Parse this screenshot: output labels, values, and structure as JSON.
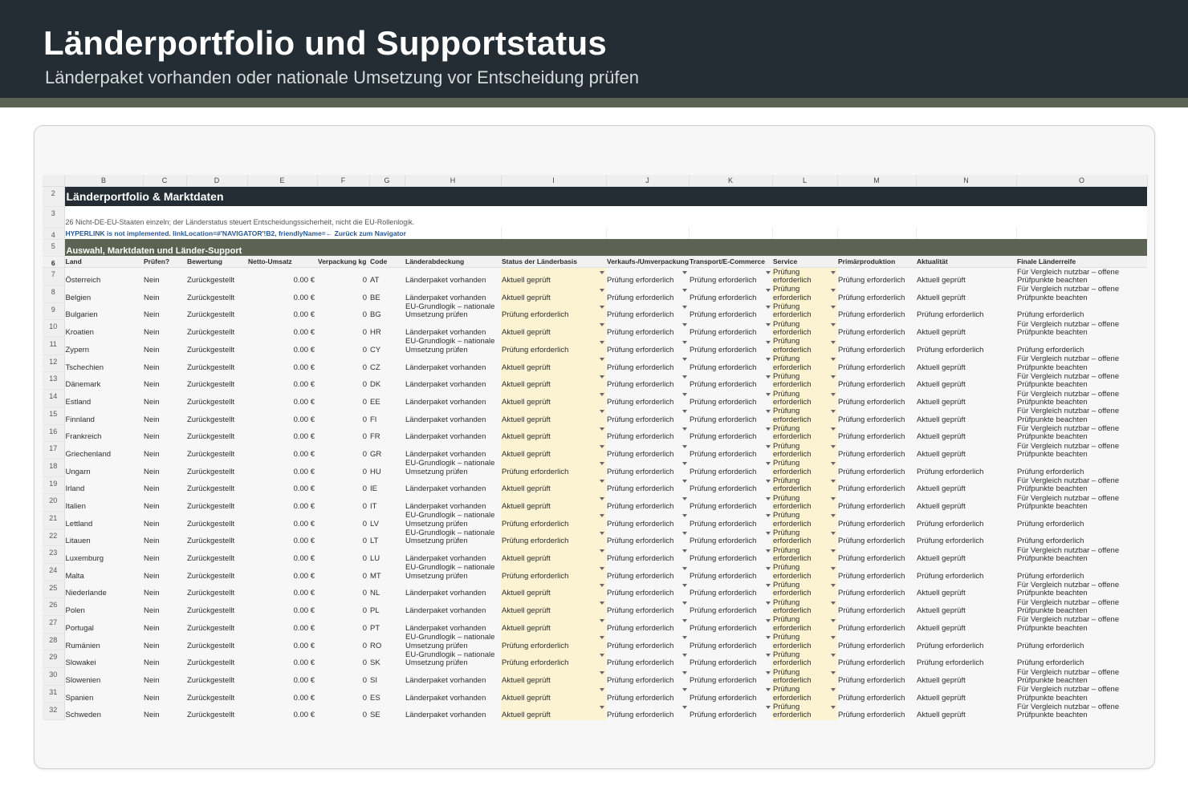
{
  "header": {
    "title": "Länderportfolio und Supportstatus",
    "subtitle": "Länderpaket vorhanden oder nationale Umsetzung vor Entscheidung prüfen"
  },
  "sheet": {
    "columns": [
      "B",
      "C",
      "D",
      "E",
      "F",
      "G",
      "H",
      "I",
      "J",
      "K",
      "L",
      "M",
      "N",
      "O"
    ],
    "title": "Länderportfolio & Marktdaten",
    "note": "26 Nicht-DE-EU-Staaten einzeln; der Länderstatus steuert Entscheidungssicherheit, nicht die EU-Rollenlogik.",
    "link": "HYPERLINK is not implemented. linkLocation=#'NAVIGATOR'!B2, friendlyName=← Zurück zum Navigator",
    "section": "Auswahl, Marktdaten und Länder-Support",
    "fields": [
      "Land",
      "Prüfen?",
      "Bewertung",
      "Netto-Umsatz",
      "Verpackung kg",
      "Code",
      "Länderabdeckung",
      "Status der Länderbasis",
      "Verkaufs-/Umverpackung",
      "Transport/E-Commerce",
      "Service",
      "Primärproduktion",
      "Aktualität",
      "Finale Länderreife"
    ],
    "rows": [
      {
        "n": "7",
        "land": "Österreich",
        "pruefen": "Nein",
        "bewertung": "Zurückgestellt",
        "umsatz": "0.00 €",
        "kg": "0",
        "code": "AT",
        "abdeckung": "Länderpaket vorhanden",
        "status": "Aktuell geprüft",
        "verkauf": "Prüfung erforderlich",
        "transport": "Prüfung erforderlich",
        "service": "Prüfung erforderlich",
        "primaer": "Prüfung erforderlich",
        "aktualitaet": "Aktuell geprüft",
        "reife": "Für Vergleich nutzbar – offene Prüfpunkte beachten"
      },
      {
        "n": "8",
        "land": "Belgien",
        "pruefen": "Nein",
        "bewertung": "Zurückgestellt",
        "umsatz": "0.00 €",
        "kg": "0",
        "code": "BE",
        "abdeckung": "Länderpaket vorhanden",
        "status": "Aktuell geprüft",
        "verkauf": "Prüfung erforderlich",
        "transport": "Prüfung erforderlich",
        "service": "Prüfung erforderlich",
        "primaer": "Prüfung erforderlich",
        "aktualitaet": "Aktuell geprüft",
        "reife": "Für Vergleich nutzbar – offene Prüfpunkte beachten"
      },
      {
        "n": "9",
        "land": "Bulgarien",
        "pruefen": "Nein",
        "bewertung": "Zurückgestellt",
        "umsatz": "0.00 €",
        "kg": "0",
        "code": "BG",
        "abdeckung": "EU-Grundlogik – nationale Umsetzung prüfen",
        "status": "Prüfung erforderlich",
        "verkauf": "Prüfung erforderlich",
        "transport": "Prüfung erforderlich",
        "service": "Prüfung erforderlich",
        "primaer": "Prüfung erforderlich",
        "aktualitaet": "Prüfung erforderlich",
        "reife": "Prüfung erforderlich"
      },
      {
        "n": "10",
        "land": "Kroatien",
        "pruefen": "Nein",
        "bewertung": "Zurückgestellt",
        "umsatz": "0.00 €",
        "kg": "0",
        "code": "HR",
        "abdeckung": "Länderpaket vorhanden",
        "status": "Aktuell geprüft",
        "verkauf": "Prüfung erforderlich",
        "transport": "Prüfung erforderlich",
        "service": "Prüfung erforderlich",
        "primaer": "Prüfung erforderlich",
        "aktualitaet": "Aktuell geprüft",
        "reife": "Für Vergleich nutzbar – offene Prüfpunkte beachten"
      },
      {
        "n": "11",
        "land": "Zypern",
        "pruefen": "Nein",
        "bewertung": "Zurückgestellt",
        "umsatz": "0.00 €",
        "kg": "0",
        "code": "CY",
        "abdeckung": "EU-Grundlogik – nationale Umsetzung prüfen",
        "status": "Prüfung erforderlich",
        "verkauf": "Prüfung erforderlich",
        "transport": "Prüfung erforderlich",
        "service": "Prüfung erforderlich",
        "primaer": "Prüfung erforderlich",
        "aktualitaet": "Prüfung erforderlich",
        "reife": "Prüfung erforderlich"
      },
      {
        "n": "12",
        "land": "Tschechien",
        "pruefen": "Nein",
        "bewertung": "Zurückgestellt",
        "umsatz": "0.00 €",
        "kg": "0",
        "code": "CZ",
        "abdeckung": "Länderpaket vorhanden",
        "status": "Aktuell geprüft",
        "verkauf": "Prüfung erforderlich",
        "transport": "Prüfung erforderlich",
        "service": "Prüfung erforderlich",
        "primaer": "Prüfung erforderlich",
        "aktualitaet": "Aktuell geprüft",
        "reife": "Für Vergleich nutzbar – offene Prüfpunkte beachten"
      },
      {
        "n": "13",
        "land": "Dänemark",
        "pruefen": "Nein",
        "bewertung": "Zurückgestellt",
        "umsatz": "0.00 €",
        "kg": "0",
        "code": "DK",
        "abdeckung": "Länderpaket vorhanden",
        "status": "Aktuell geprüft",
        "verkauf": "Prüfung erforderlich",
        "transport": "Prüfung erforderlich",
        "service": "Prüfung erforderlich",
        "primaer": "Prüfung erforderlich",
        "aktualitaet": "Aktuell geprüft",
        "reife": "Für Vergleich nutzbar – offene Prüfpunkte beachten"
      },
      {
        "n": "14",
        "land": "Estland",
        "pruefen": "Nein",
        "bewertung": "Zurückgestellt",
        "umsatz": "0.00 €",
        "kg": "0",
        "code": "EE",
        "abdeckung": "Länderpaket vorhanden",
        "status": "Aktuell geprüft",
        "verkauf": "Prüfung erforderlich",
        "transport": "Prüfung erforderlich",
        "service": "Prüfung erforderlich",
        "primaer": "Prüfung erforderlich",
        "aktualitaet": "Aktuell geprüft",
        "reife": "Für Vergleich nutzbar – offene Prüfpunkte beachten"
      },
      {
        "n": "15",
        "land": "Finnland",
        "pruefen": "Nein",
        "bewertung": "Zurückgestellt",
        "umsatz": "0.00 €",
        "kg": "0",
        "code": "FI",
        "abdeckung": "Länderpaket vorhanden",
        "status": "Aktuell geprüft",
        "verkauf": "Prüfung erforderlich",
        "transport": "Prüfung erforderlich",
        "service": "Prüfung erforderlich",
        "primaer": "Prüfung erforderlich",
        "aktualitaet": "Aktuell geprüft",
        "reife": "Für Vergleich nutzbar – offene Prüfpunkte beachten"
      },
      {
        "n": "16",
        "land": "Frankreich",
        "pruefen": "Nein",
        "bewertung": "Zurückgestellt",
        "umsatz": "0.00 €",
        "kg": "0",
        "code": "FR",
        "abdeckung": "Länderpaket vorhanden",
        "status": "Aktuell geprüft",
        "verkauf": "Prüfung erforderlich",
        "transport": "Prüfung erforderlich",
        "service": "Prüfung erforderlich",
        "primaer": "Prüfung erforderlich",
        "aktualitaet": "Aktuell geprüft",
        "reife": "Für Vergleich nutzbar – offene Prüfpunkte beachten"
      },
      {
        "n": "17",
        "land": "Griechenland",
        "pruefen": "Nein",
        "bewertung": "Zurückgestellt",
        "umsatz": "0.00 €",
        "kg": "0",
        "code": "GR",
        "abdeckung": "Länderpaket vorhanden",
        "status": "Aktuell geprüft",
        "verkauf": "Prüfung erforderlich",
        "transport": "Prüfung erforderlich",
        "service": "Prüfung erforderlich",
        "primaer": "Prüfung erforderlich",
        "aktualitaet": "Aktuell geprüft",
        "reife": "Für Vergleich nutzbar – offene Prüfpunkte beachten"
      },
      {
        "n": "18",
        "land": "Ungarn",
        "pruefen": "Nein",
        "bewertung": "Zurückgestellt",
        "umsatz": "0.00 €",
        "kg": "0",
        "code": "HU",
        "abdeckung": "EU-Grundlogik – nationale Umsetzung prüfen",
        "status": "Prüfung erforderlich",
        "verkauf": "Prüfung erforderlich",
        "transport": "Prüfung erforderlich",
        "service": "Prüfung erforderlich",
        "primaer": "Prüfung erforderlich",
        "aktualitaet": "Prüfung erforderlich",
        "reife": "Prüfung erforderlich"
      },
      {
        "n": "19",
        "land": "Irland",
        "pruefen": "Nein",
        "bewertung": "Zurückgestellt",
        "umsatz": "0.00 €",
        "kg": "0",
        "code": "IE",
        "abdeckung": "Länderpaket vorhanden",
        "status": "Aktuell geprüft",
        "verkauf": "Prüfung erforderlich",
        "transport": "Prüfung erforderlich",
        "service": "Prüfung erforderlich",
        "primaer": "Prüfung erforderlich",
        "aktualitaet": "Aktuell geprüft",
        "reife": "Für Vergleich nutzbar – offene Prüfpunkte beachten"
      },
      {
        "n": "20",
        "land": "Italien",
        "pruefen": "Nein",
        "bewertung": "Zurückgestellt",
        "umsatz": "0.00 €",
        "kg": "0",
        "code": "IT",
        "abdeckung": "Länderpaket vorhanden",
        "status": "Aktuell geprüft",
        "verkauf": "Prüfung erforderlich",
        "transport": "Prüfung erforderlich",
        "service": "Prüfung erforderlich",
        "primaer": "Prüfung erforderlich",
        "aktualitaet": "Aktuell geprüft",
        "reife": "Für Vergleich nutzbar – offene Prüfpunkte beachten"
      },
      {
        "n": "21",
        "land": "Lettland",
        "pruefen": "Nein",
        "bewertung": "Zurückgestellt",
        "umsatz": "0.00 €",
        "kg": "0",
        "code": "LV",
        "abdeckung": "EU-Grundlogik – nationale Umsetzung prüfen",
        "status": "Prüfung erforderlich",
        "verkauf": "Prüfung erforderlich",
        "transport": "Prüfung erforderlich",
        "service": "Prüfung erforderlich",
        "primaer": "Prüfung erforderlich",
        "aktualitaet": "Prüfung erforderlich",
        "reife": "Prüfung erforderlich"
      },
      {
        "n": "22",
        "land": "Litauen",
        "pruefen": "Nein",
        "bewertung": "Zurückgestellt",
        "umsatz": "0.00 €",
        "kg": "0",
        "code": "LT",
        "abdeckung": "EU-Grundlogik – nationale Umsetzung prüfen",
        "status": "Prüfung erforderlich",
        "verkauf": "Prüfung erforderlich",
        "transport": "Prüfung erforderlich",
        "service": "Prüfung erforderlich",
        "primaer": "Prüfung erforderlich",
        "aktualitaet": "Prüfung erforderlich",
        "reife": "Prüfung erforderlich"
      },
      {
        "n": "23",
        "land": "Luxemburg",
        "pruefen": "Nein",
        "bewertung": "Zurückgestellt",
        "umsatz": "0.00 €",
        "kg": "0",
        "code": "LU",
        "abdeckung": "Länderpaket vorhanden",
        "status": "Aktuell geprüft",
        "verkauf": "Prüfung erforderlich",
        "transport": "Prüfung erforderlich",
        "service": "Prüfung erforderlich",
        "primaer": "Prüfung erforderlich",
        "aktualitaet": "Aktuell geprüft",
        "reife": "Für Vergleich nutzbar – offene Prüfpunkte beachten"
      },
      {
        "n": "24",
        "land": "Malta",
        "pruefen": "Nein",
        "bewertung": "Zurückgestellt",
        "umsatz": "0.00 €",
        "kg": "0",
        "code": "MT",
        "abdeckung": "EU-Grundlogik – nationale Umsetzung prüfen",
        "status": "Prüfung erforderlich",
        "verkauf": "Prüfung erforderlich",
        "transport": "Prüfung erforderlich",
        "service": "Prüfung erforderlich",
        "primaer": "Prüfung erforderlich",
        "aktualitaet": "Prüfung erforderlich",
        "reife": "Prüfung erforderlich"
      },
      {
        "n": "25",
        "land": "Niederlande",
        "pruefen": "Nein",
        "bewertung": "Zurückgestellt",
        "umsatz": "0.00 €",
        "kg": "0",
        "code": "NL",
        "abdeckung": "Länderpaket vorhanden",
        "status": "Aktuell geprüft",
        "verkauf": "Prüfung erforderlich",
        "transport": "Prüfung erforderlich",
        "service": "Prüfung erforderlich",
        "primaer": "Prüfung erforderlich",
        "aktualitaet": "Aktuell geprüft",
        "reife": "Für Vergleich nutzbar – offene Prüfpunkte beachten"
      },
      {
        "n": "26",
        "land": "Polen",
        "pruefen": "Nein",
        "bewertung": "Zurückgestellt",
        "umsatz": "0.00 €",
        "kg": "0",
        "code": "PL",
        "abdeckung": "Länderpaket vorhanden",
        "status": "Aktuell geprüft",
        "verkauf": "Prüfung erforderlich",
        "transport": "Prüfung erforderlich",
        "service": "Prüfung erforderlich",
        "primaer": "Prüfung erforderlich",
        "aktualitaet": "Aktuell geprüft",
        "reife": "Für Vergleich nutzbar – offene Prüfpunkte beachten"
      },
      {
        "n": "27",
        "land": "Portugal",
        "pruefen": "Nein",
        "bewertung": "Zurückgestellt",
        "umsatz": "0.00 €",
        "kg": "0",
        "code": "PT",
        "abdeckung": "Länderpaket vorhanden",
        "status": "Aktuell geprüft",
        "verkauf": "Prüfung erforderlich",
        "transport": "Prüfung erforderlich",
        "service": "Prüfung erforderlich",
        "primaer": "Prüfung erforderlich",
        "aktualitaet": "Aktuell geprüft",
        "reife": "Für Vergleich nutzbar – offene Prüfpunkte beachten"
      },
      {
        "n": "28",
        "land": "Rumänien",
        "pruefen": "Nein",
        "bewertung": "Zurückgestellt",
        "umsatz": "0.00 €",
        "kg": "0",
        "code": "RO",
        "abdeckung": "EU-Grundlogik – nationale Umsetzung prüfen",
        "status": "Prüfung erforderlich",
        "verkauf": "Prüfung erforderlich",
        "transport": "Prüfung erforderlich",
        "service": "Prüfung erforderlich",
        "primaer": "Prüfung erforderlich",
        "aktualitaet": "Prüfung erforderlich",
        "reife": "Prüfung erforderlich"
      },
      {
        "n": "29",
        "land": "Slowakei",
        "pruefen": "Nein",
        "bewertung": "Zurückgestellt",
        "umsatz": "0.00 €",
        "kg": "0",
        "code": "SK",
        "abdeckung": "EU-Grundlogik – nationale Umsetzung prüfen",
        "status": "Prüfung erforderlich",
        "verkauf": "Prüfung erforderlich",
        "transport": "Prüfung erforderlich",
        "service": "Prüfung erforderlich",
        "primaer": "Prüfung erforderlich",
        "aktualitaet": "Prüfung erforderlich",
        "reife": "Prüfung erforderlich"
      },
      {
        "n": "30",
        "land": "Slowenien",
        "pruefen": "Nein",
        "bewertung": "Zurückgestellt",
        "umsatz": "0.00 €",
        "kg": "0",
        "code": "SI",
        "abdeckung": "Länderpaket vorhanden",
        "status": "Aktuell geprüft",
        "verkauf": "Prüfung erforderlich",
        "transport": "Prüfung erforderlich",
        "service": "Prüfung erforderlich",
        "primaer": "Prüfung erforderlich",
        "aktualitaet": "Aktuell geprüft",
        "reife": "Für Vergleich nutzbar – offene Prüfpunkte beachten"
      },
      {
        "n": "31",
        "land": "Spanien",
        "pruefen": "Nein",
        "bewertung": "Zurückgestellt",
        "umsatz": "0.00 €",
        "kg": "0",
        "code": "ES",
        "abdeckung": "Länderpaket vorhanden",
        "status": "Aktuell geprüft",
        "verkauf": "Prüfung erforderlich",
        "transport": "Prüfung erforderlich",
        "service": "Prüfung erforderlich",
        "primaer": "Prüfung erforderlich",
        "aktualitaet": "Aktuell geprüft",
        "reife": "Für Vergleich nutzbar – offene Prüfpunkte beachten"
      },
      {
        "n": "32",
        "land": "Schweden",
        "pruefen": "Nein",
        "bewertung": "Zurückgestellt",
        "umsatz": "0.00 €",
        "kg": "0",
        "code": "SE",
        "abdeckung": "Länderpaket vorhanden",
        "status": "Aktuell geprüft",
        "verkauf": "Prüfung erforderlich",
        "transport": "Prüfung erforderlich",
        "service": "Prüfung erforderlich",
        "primaer": "Prüfung erforderlich",
        "aktualitaet": "Aktuell geprüft",
        "reife": "Für Vergleich nutzbar – offene Prüfpunkte beachten"
      }
    ]
  },
  "colors": {
    "header_bg": "#232d33",
    "accent": "#5d6352",
    "status_fill": "#fbf3d2",
    "link": "#2a5a94"
  }
}
